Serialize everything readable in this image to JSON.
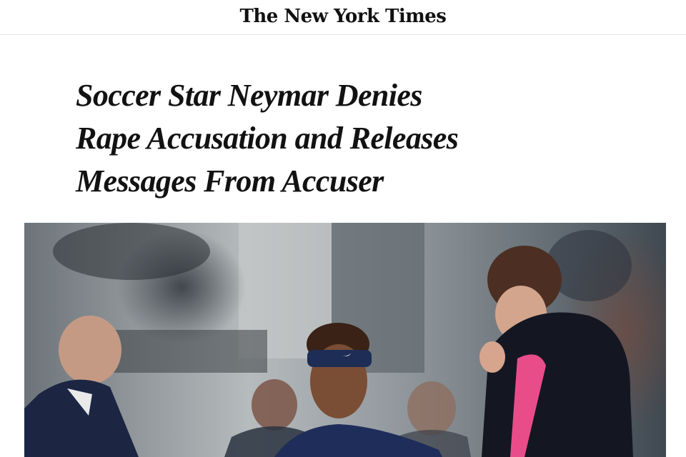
{
  "header": {
    "masthead": "The New York Times"
  },
  "article": {
    "headline_lines": [
      "Soccer Star Neymar Denies",
      "Rape Accusation and Releases",
      "Messages From Accuser"
    ]
  },
  "photo": {
    "subject": "article-lead-photo"
  },
  "colors": {
    "text": "#121212",
    "divider": "#e2e2e2",
    "jacket_stripe": "#e84d8a",
    "navy": "#1d2746"
  }
}
